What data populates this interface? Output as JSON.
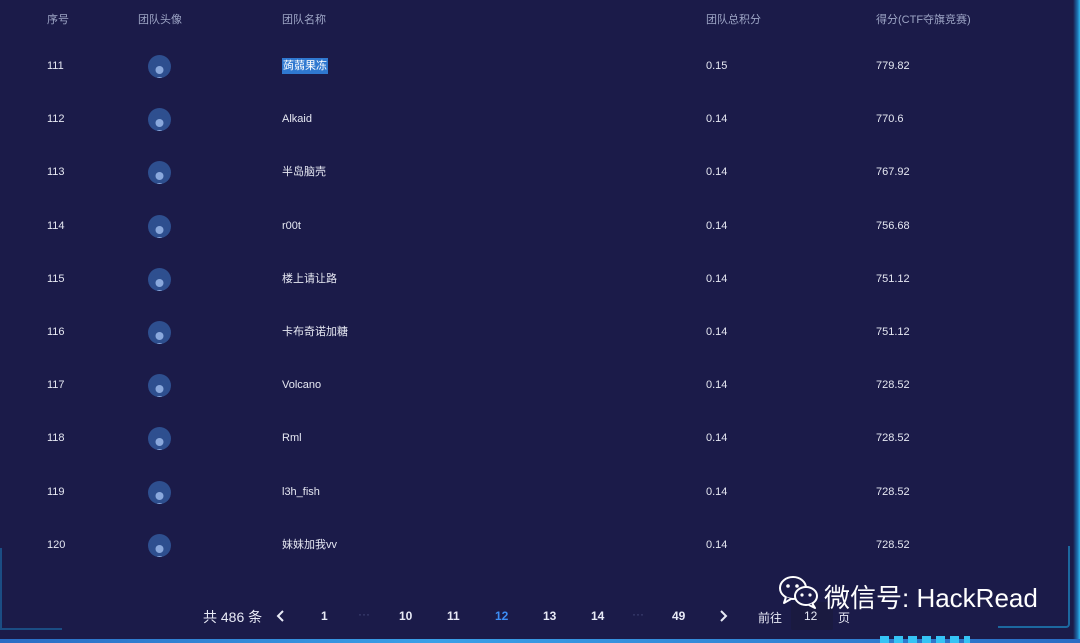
{
  "columns": [
    "序号",
    "团队头像",
    "团队名称",
    "团队总积分",
    "得分(CTF夺旗竞赛)"
  ],
  "rows": [
    {
      "rank": "111",
      "name": "蒟蒻果冻",
      "total": "0.15",
      "score": "779.82"
    },
    {
      "rank": "112",
      "name": "Alkaid",
      "total": "0.14",
      "score": "770.6"
    },
    {
      "rank": "113",
      "name": "半岛脑壳",
      "total": "0.14",
      "score": "767.92"
    },
    {
      "rank": "114",
      "name": "r00t",
      "total": "0.14",
      "score": "756.68"
    },
    {
      "rank": "115",
      "name": "楼上请让路",
      "total": "0.14",
      "score": "751.12"
    },
    {
      "rank": "116",
      "name": "卡布奇诺加糖",
      "total": "0.14",
      "score": "751.12"
    },
    {
      "rank": "117",
      "name": "Volcano",
      "total": "0.14",
      "score": "728.52"
    },
    {
      "rank": "118",
      "name": "Rml",
      "total": "0.14",
      "score": "728.52"
    },
    {
      "rank": "119",
      "name": "l3h_fish",
      "total": "0.14",
      "score": "728.52"
    },
    {
      "rank": "120",
      "name": "妹妹加我vv",
      "total": "0.14",
      "score": "728.52"
    }
  ],
  "pagination": {
    "total_label": "共 486 条",
    "pages": [
      "1",
      "10",
      "11",
      "12",
      "13",
      "14",
      "49"
    ],
    "dots": "···",
    "current": "12",
    "goto_prefix": "前往",
    "goto_value": "12",
    "goto_suffix": "页"
  },
  "watermark": {
    "text": "微信号: HackRead"
  },
  "icons": {
    "avatar": "user-avatar-icon",
    "prev": "chevron-left-icon",
    "next": "chevron-right-icon",
    "wechat": "wechat-icon"
  },
  "colors": {
    "background": "#1b1b49",
    "active_page": "#3d8df5",
    "selection": "#2f78d0"
  }
}
